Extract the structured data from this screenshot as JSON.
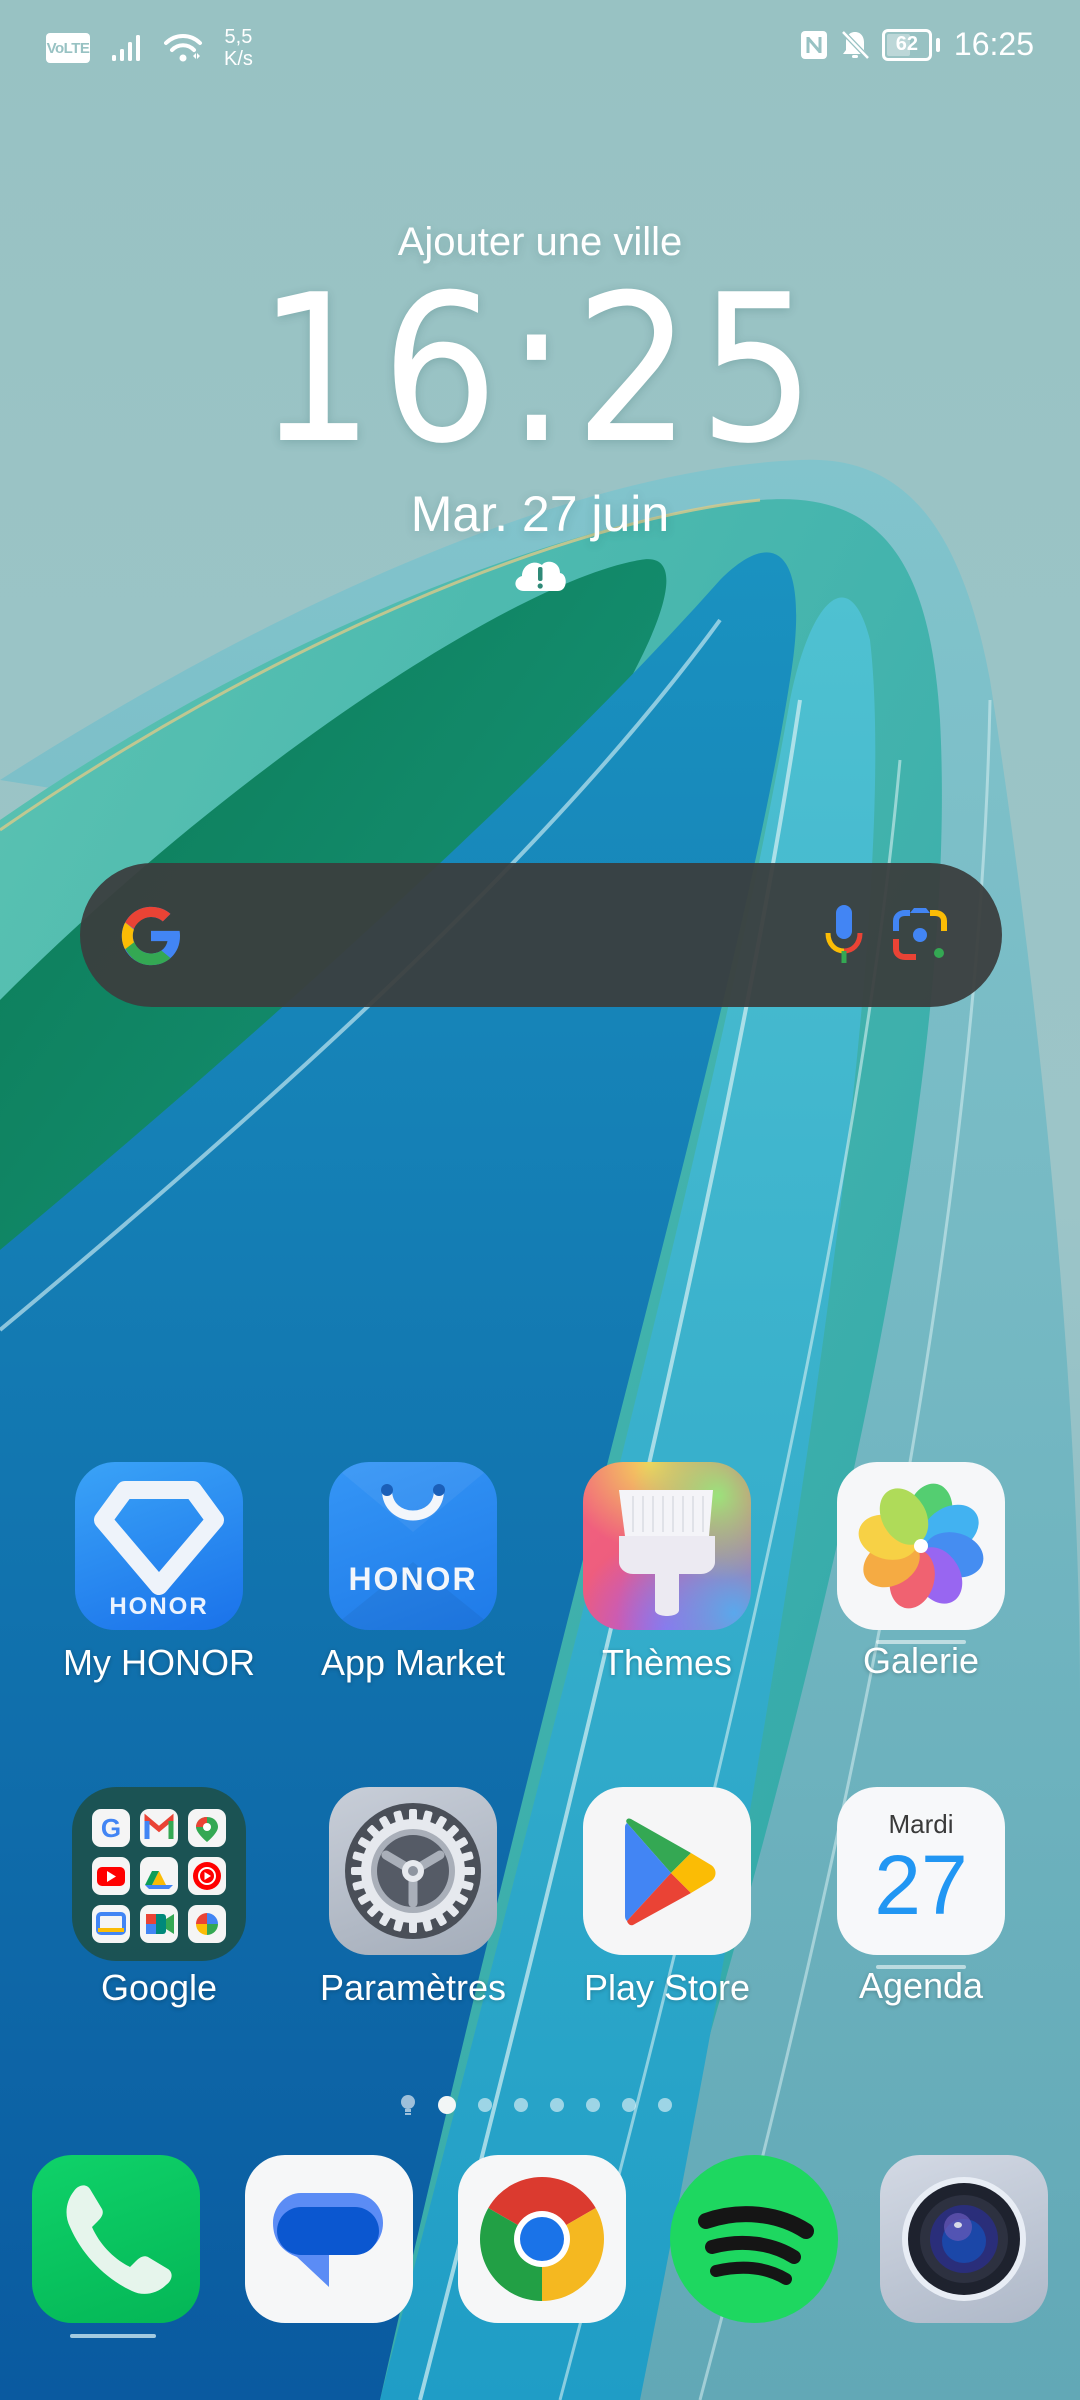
{
  "status_bar": {
    "left_icons": [
      "volte-icon",
      "signal-icon",
      "wifi-icon"
    ],
    "volte_label": "VoLTE",
    "net_speed_value": "5,5",
    "net_speed_unit": "K/s",
    "right_icons": [
      "nfc-icon",
      "bell-off-icon",
      "battery-icon"
    ],
    "battery_percent": "62",
    "battery_level": 0.62,
    "time": "16:25"
  },
  "clock_widget": {
    "city": "Ajouter une ville",
    "time": "16:25",
    "date": "Mar. 27 juin",
    "weather_icon": "cloud-alert-icon"
  },
  "search_widget": {
    "logo": "google-g-icon",
    "voice": "mic-icon",
    "lens": "google-lens-icon"
  },
  "apps": [
    {
      "label": "My HONOR",
      "icon": "my-honor-icon",
      "brand_text": "HONOR",
      "new_indicator": false
    },
    {
      "label": "App Market",
      "icon": "app-market-icon",
      "brand_text": "HONOR",
      "new_indicator": false
    },
    {
      "label": "Thèmes",
      "icon": "themes-brush-icon",
      "new_indicator": false
    },
    {
      "label": "Galerie",
      "icon": "gallery-flower-icon",
      "new_indicator": true
    },
    {
      "label": "Google",
      "icon": "google-folder-icon",
      "folder_apps": [
        "Google",
        "Gmail",
        "Maps",
        "YouTube",
        "Drive",
        "YouTube Music",
        "Google TV",
        "Meet",
        "Photos"
      ],
      "new_indicator": false
    },
    {
      "label": "Paramètres",
      "icon": "settings-gear-icon",
      "new_indicator": false
    },
    {
      "label": "Play Store",
      "icon": "play-store-icon",
      "new_indicator": false
    },
    {
      "label": "Agenda",
      "icon": "calendar-icon",
      "calendar_day": "Mardi",
      "calendar_date": "27",
      "new_indicator": true
    }
  ],
  "page_indicator": {
    "total_pages": 7,
    "current_page": 1,
    "has_assistant_page": true
  },
  "dock": [
    {
      "name": "Téléphone",
      "icon": "phone-icon",
      "active": true
    },
    {
      "name": "Messages",
      "icon": "messages-icon"
    },
    {
      "name": "Chrome",
      "icon": "chrome-icon"
    },
    {
      "name": "Spotify",
      "icon": "spotify-icon"
    },
    {
      "name": "Appareil photo",
      "icon": "camera-icon"
    }
  ],
  "colors": {
    "wallpaper_base": "#98c2c3",
    "search_bg": "#3a3e3e",
    "honor_blue": "#2f86f0",
    "phone_green": "#05c45c",
    "spotify_green": "#1ed760",
    "calendar_blue": "#2196f3"
  }
}
